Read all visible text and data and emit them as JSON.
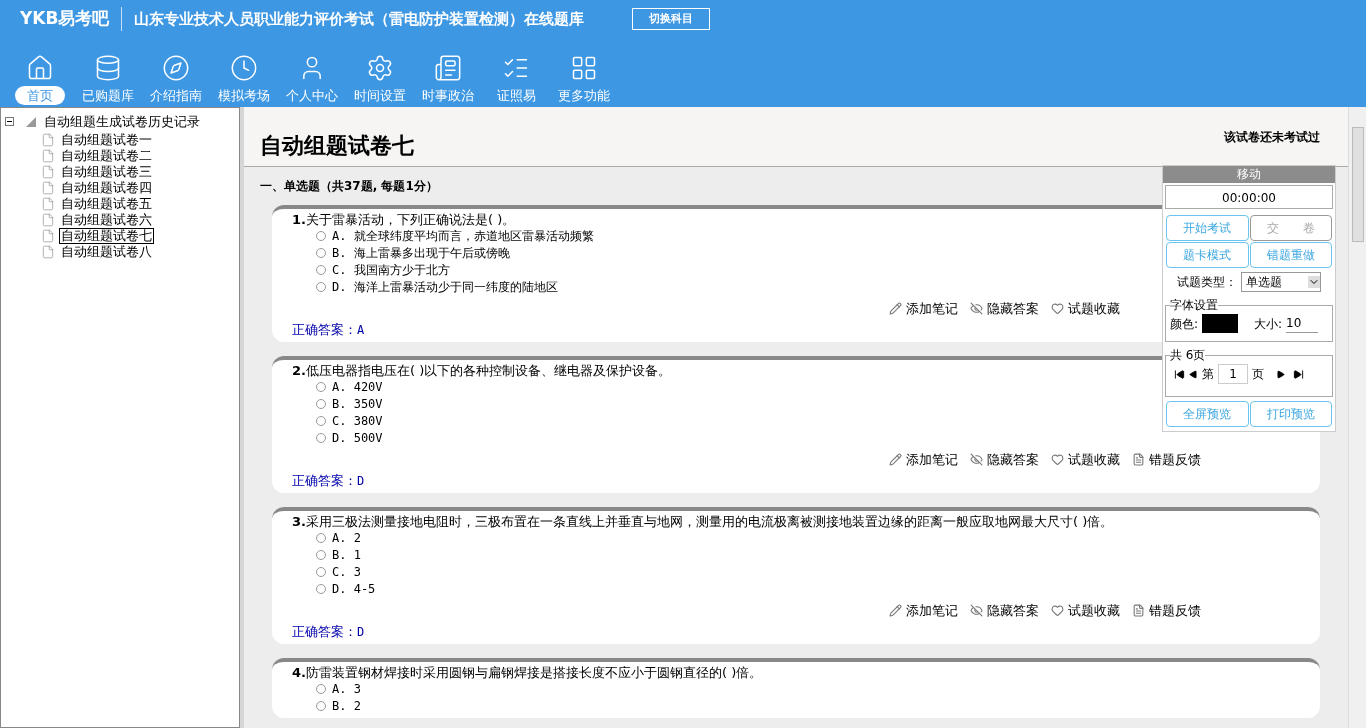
{
  "header": {
    "logo": "YKB易考吧",
    "title": "山东专业技术人员职业能力评价考试（雷电防护装置检测）在线题库",
    "switch_button": "切换科目"
  },
  "toolbar": [
    {
      "label": "首页",
      "selected": true
    },
    {
      "label": "已购题库",
      "selected": false
    },
    {
      "label": "介绍指南",
      "selected": false
    },
    {
      "label": "模拟考场",
      "selected": false
    },
    {
      "label": "个人中心",
      "selected": false
    },
    {
      "label": "时间设置",
      "selected": false
    },
    {
      "label": "时事政治",
      "selected": false
    },
    {
      "label": "证照易",
      "selected": false
    },
    {
      "label": "更多功能",
      "selected": false
    }
  ],
  "tree": {
    "label": "自动组题生成试卷历史记录",
    "expanded": true,
    "children": [
      {
        "label": "自动组题试卷一",
        "selected": false
      },
      {
        "label": "自动组题试卷二",
        "selected": false
      },
      {
        "label": "自动组题试卷三",
        "selected": false
      },
      {
        "label": "自动组题试卷四",
        "selected": false
      },
      {
        "label": "自动组题试卷五",
        "selected": false
      },
      {
        "label": "自动组题试卷六",
        "selected": false
      },
      {
        "label": "自动组题试卷七",
        "selected": true
      },
      {
        "label": "自动组题试卷八",
        "selected": false
      }
    ]
  },
  "paper": {
    "title": "自动组题试卷七",
    "status": "该试卷还未考试过",
    "section": "一、单选题（共37题, 每题1分）",
    "questions": [
      {
        "number": "1.",
        "text": "关于雷暴活动，下列正确说法是( )。",
        "options": [
          {
            "text": "A. 就全球纬度平均而言，赤道地区雷暴活动频繁",
            "selected": false
          },
          {
            "text": "B. 海上雷暴多出现于午后或傍晚",
            "selected": false
          },
          {
            "text": "C. 我国南方少于北方",
            "selected": false
          },
          {
            "text": "D. 海洋上雷暴活动少于同一纬度的陆地区",
            "selected": false
          }
        ],
        "actions": [
          "添加笔记",
          "隐藏答案",
          "试题收藏"
        ],
        "answer_label": "正确答案：",
        "answer": "A"
      },
      {
        "number": "2.",
        "text": "低压电器指电压在( )以下的各种控制设备、继电器及保护设备。",
        "options": [
          {
            "text": "A. 420V",
            "selected": false
          },
          {
            "text": "B. 350V",
            "selected": false
          },
          {
            "text": "C. 380V",
            "selected": false
          },
          {
            "text": "D. 500V",
            "selected": false
          }
        ],
        "actions": [
          "添加笔记",
          "隐藏答案",
          "试题收藏",
          "错题反馈"
        ],
        "answer_label": "正确答案：",
        "answer": "D"
      },
      {
        "number": "3.",
        "text": "采用三极法测量接地电阻时，三极布置在一条直线上并垂直与地网，测量用的电流极离被测接地装置边缘的距离一般应取地网最大尺寸( )倍。",
        "options": [
          {
            "text": "A. 2",
            "selected": false
          },
          {
            "text": "B. 1",
            "selected": false
          },
          {
            "text": "C. 3",
            "selected": false
          },
          {
            "text": "D. 4-5",
            "selected": false
          }
        ],
        "actions": [
          "添加笔记",
          "隐藏答案",
          "试题收藏",
          "错题反馈"
        ],
        "answer_label": "正确答案：",
        "answer": "D"
      },
      {
        "number": "4.",
        "text": "防雷装置钢材焊接时采用圆钢与扁钢焊接是搭接长度不应小于圆钢直径的( )倍。",
        "options": [
          {
            "text": "A. 3",
            "selected": false
          },
          {
            "text": "B. 2",
            "selected": false
          }
        ]
      }
    ]
  },
  "panel": {
    "title": "移动",
    "timer": "00:00:00",
    "buttons": [
      {
        "label": "开始考试",
        "disabled": false
      },
      {
        "label": "交　　卷",
        "disabled": true
      },
      {
        "label": "题卡模式",
        "disabled": false
      },
      {
        "label": "错题重做",
        "disabled": false
      }
    ],
    "type_label": "试题类型：",
    "type_value": "单选题",
    "font_legend": "字体设置",
    "color_label": "颜色:",
    "size_label": "大小:",
    "size_value": "10",
    "pages_legend": "共 6页",
    "page_prefix": "第",
    "page_value": "1",
    "page_suffix": "页",
    "bottom_buttons": [
      "全屏预览",
      "打印预览"
    ]
  }
}
